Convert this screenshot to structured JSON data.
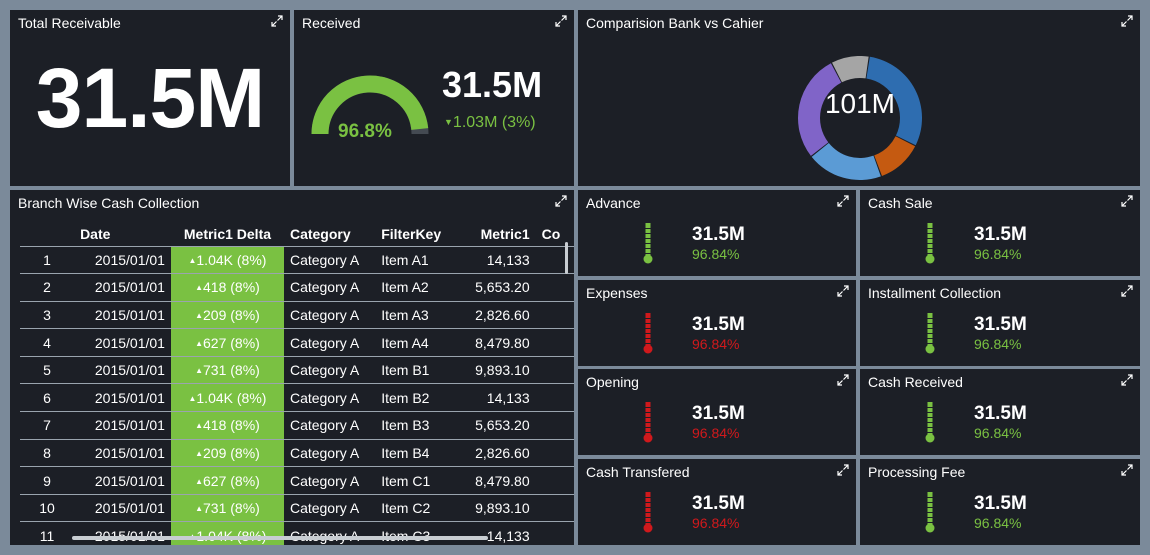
{
  "colors": {
    "background": "#7b8a9a",
    "panel": "#1c1f26",
    "positive": "#7ac142",
    "negative": "#d0191c"
  },
  "panels": {
    "total_receivable": {
      "title": "Total Receivable",
      "value": "31.5M"
    },
    "received": {
      "title": "Received",
      "gauge_percent": "96.8%",
      "gauge_fraction": 0.968,
      "value": "31.5M",
      "delta": "1.03M (3%)",
      "delta_direction": "down"
    },
    "comparison": {
      "title": "Comparision Bank vs Cahier",
      "center_label": "101M"
    },
    "branch": {
      "title": "Branch Wise Cash Collection",
      "columns": [
        "",
        "Date",
        "Metric1 Delta",
        "Category",
        "FilterKey",
        "Metric1",
        "Co"
      ],
      "rows": [
        [
          "1",
          "2015/01/01",
          "1.04K (8%)",
          "Category A",
          "Item A1",
          "14,133"
        ],
        [
          "2",
          "2015/01/01",
          "418 (8%)",
          "Category A",
          "Item A2",
          "5,653.20"
        ],
        [
          "3",
          "2015/01/01",
          "209 (8%)",
          "Category A",
          "Item A3",
          "2,826.60"
        ],
        [
          "4",
          "2015/01/01",
          "627 (8%)",
          "Category A",
          "Item A4",
          "8,479.80"
        ],
        [
          "5",
          "2015/01/01",
          "731 (8%)",
          "Category A",
          "Item B1",
          "9,893.10"
        ],
        [
          "6",
          "2015/01/01",
          "1.04K (8%)",
          "Category A",
          "Item B2",
          "14,133"
        ],
        [
          "7",
          "2015/01/01",
          "418 (8%)",
          "Category A",
          "Item B3",
          "5,653.20"
        ],
        [
          "8",
          "2015/01/01",
          "209 (8%)",
          "Category A",
          "Item B4",
          "2,826.60"
        ],
        [
          "9",
          "2015/01/01",
          "627 (8%)",
          "Category A",
          "Item C1",
          "8,479.80"
        ],
        [
          "10",
          "2015/01/01",
          "731 (8%)",
          "Category A",
          "Item C2",
          "9,893.10"
        ],
        [
          "11",
          "2015/01/01",
          "1.04K (8%)",
          "Category A",
          "Item C3",
          "14,133"
        ]
      ]
    }
  },
  "kpis": [
    {
      "title": "Advance",
      "value": "31.5M",
      "percent": "96.84%",
      "status": "positive"
    },
    {
      "title": "Cash Sale",
      "value": "31.5M",
      "percent": "96.84%",
      "status": "positive"
    },
    {
      "title": "Expenses",
      "value": "31.5M",
      "percent": "96.84%",
      "status": "negative"
    },
    {
      "title": "Installment Collection",
      "value": "31.5M",
      "percent": "96.84%",
      "status": "positive"
    },
    {
      "title": "Opening",
      "value": "31.5M",
      "percent": "96.84%",
      "status": "negative"
    },
    {
      "title": "Cash Received",
      "value": "31.5M",
      "percent": "96.84%",
      "status": "positive"
    },
    {
      "title": "Cash Transfered",
      "value": "31.5M",
      "percent": "96.84%",
      "status": "negative"
    },
    {
      "title": "Processing Fee",
      "value": "31.5M",
      "percent": "96.84%",
      "status": "positive"
    }
  ],
  "chart_data": {
    "type": "pie",
    "donut": true,
    "center_label": "101M",
    "slices": [
      {
        "value": 30,
        "color": "#2e6db0"
      },
      {
        "value": 12,
        "color": "#c55a11"
      },
      {
        "value": 20,
        "color": "#5b9bd5"
      },
      {
        "value": 28,
        "color": "#8064c8"
      },
      {
        "value": 10,
        "color": "#a5a5a5"
      }
    ]
  }
}
